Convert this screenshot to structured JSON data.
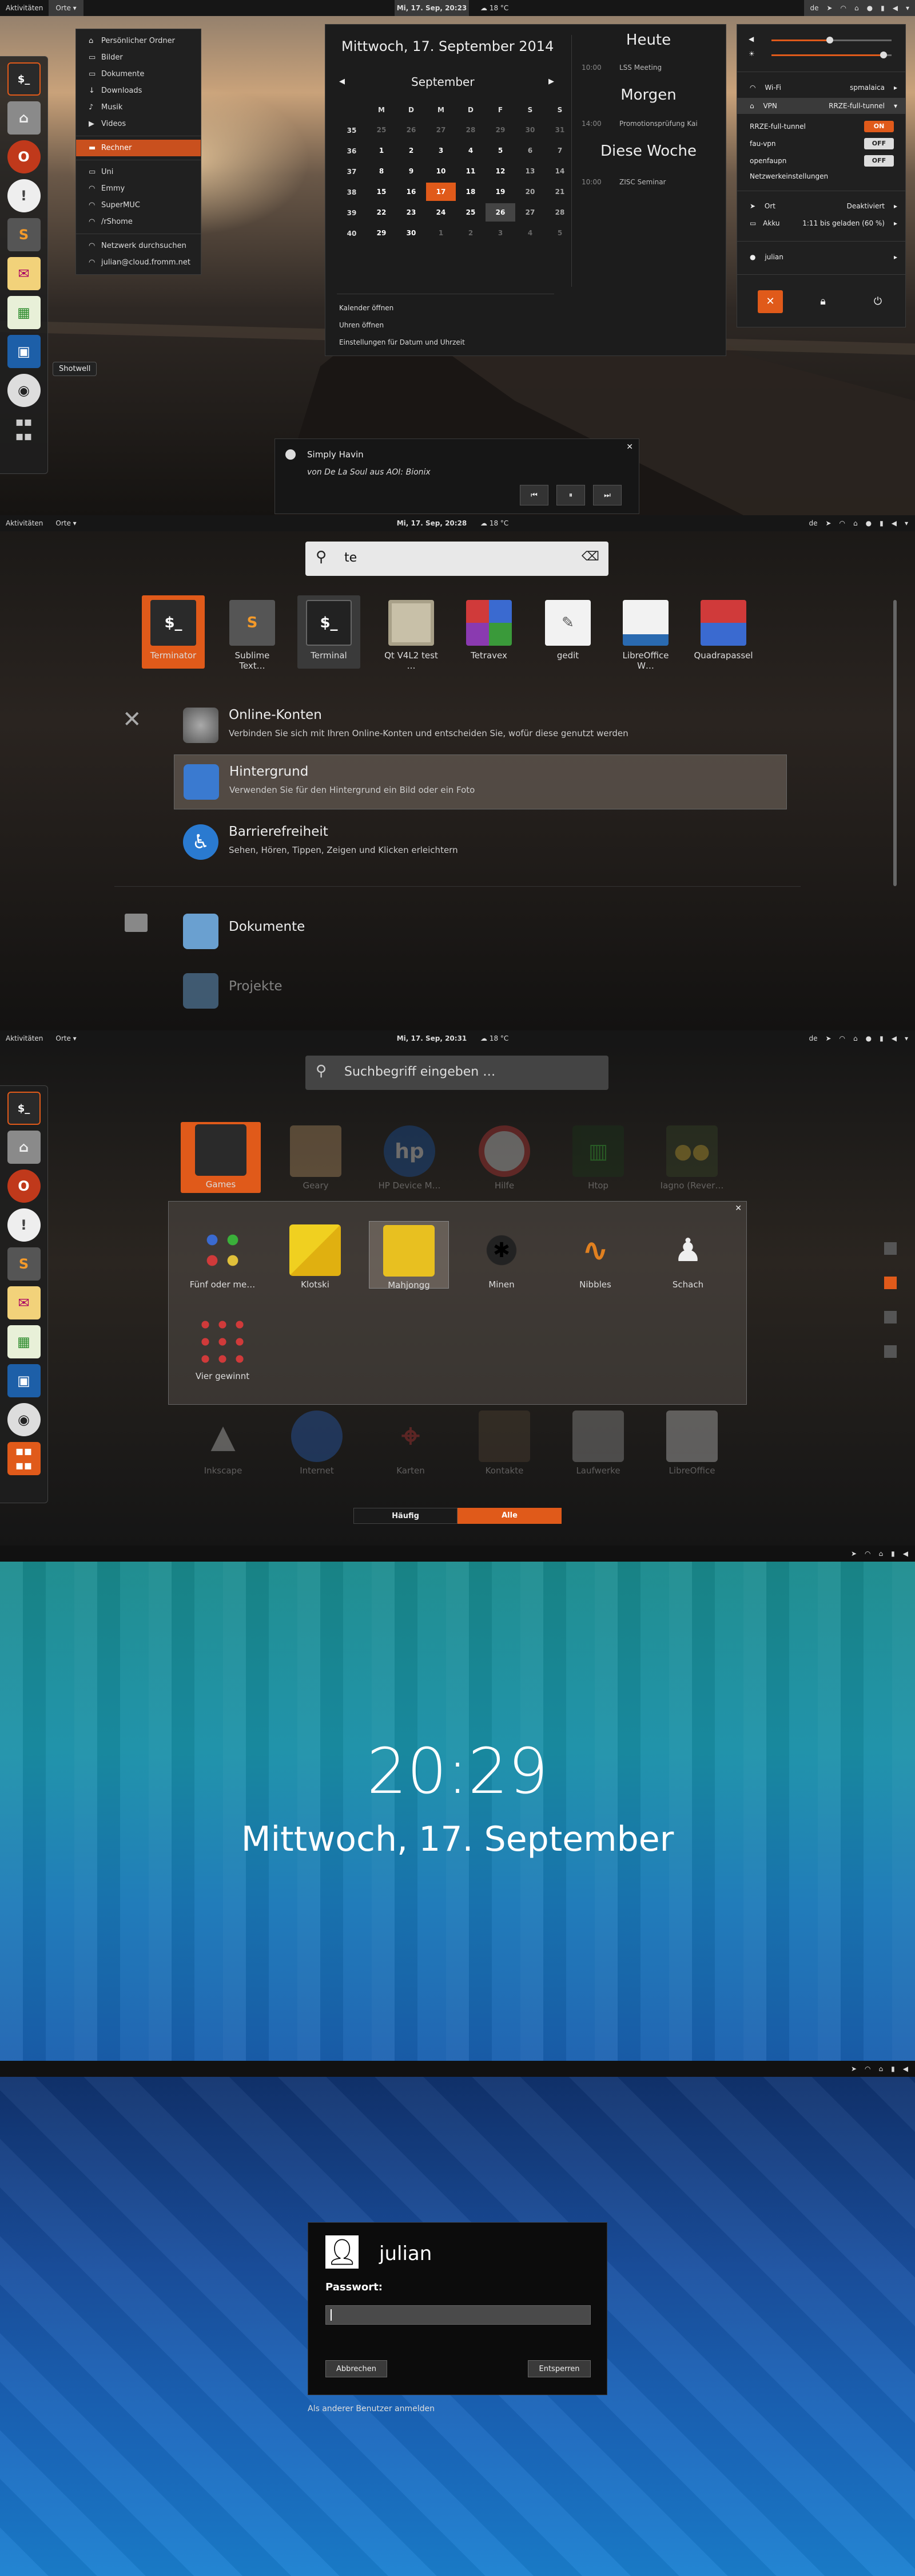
{
  "s1": {
    "topbar": {
      "activities": "Aktivitäten",
      "places": "Orte",
      "clock": "Mi, 17. Sep, 20:23",
      "temp": "18 °C",
      "lang": "de"
    },
    "places_menu": [
      "Persönlicher Ordner",
      "Bilder",
      "Dokumente",
      "Downloads",
      "Musik",
      "Videos",
      "Rechner",
      "Uni",
      "Emmy",
      "SuperMUC",
      "/rShome",
      "Netzwerk durchsuchen",
      "julian@cloud.fromm.net"
    ],
    "dock_tooltip": "Shotwell",
    "calendar": {
      "date_title": "Mittwoch, 17. September 2014",
      "month": "September",
      "weekdays": [
        "M",
        "D",
        "M",
        "D",
        "F",
        "S",
        "S"
      ],
      "weeks": [
        {
          "w": "35",
          "d": [
            "25",
            "26",
            "27",
            "28",
            "29",
            "30",
            "31"
          ]
        },
        {
          "w": "36",
          "d": [
            "1",
            "2",
            "3",
            "4",
            "5",
            "6",
            "7"
          ]
        },
        {
          "w": "37",
          "d": [
            "8",
            "9",
            "10",
            "11",
            "12",
            "13",
            "14"
          ]
        },
        {
          "w": "38",
          "d": [
            "15",
            "16",
            "17",
            "18",
            "19",
            "20",
            "21"
          ]
        },
        {
          "w": "39",
          "d": [
            "22",
            "23",
            "24",
            "25",
            "26",
            "27",
            "28"
          ]
        },
        {
          "w": "40",
          "d": [
            "29",
            "30",
            "1",
            "2",
            "3",
            "4",
            "5"
          ]
        }
      ],
      "today_label": "Heute",
      "today_events": [
        {
          "time": "10:00",
          "text": "LSS Meeting"
        }
      ],
      "tomorrow_label": "Morgen",
      "tomorrow_events": [
        {
          "time": "14:00",
          "text": "Promotionsprüfung Kai"
        }
      ],
      "week_label": "Diese Woche",
      "week_events": [
        {
          "time": "10:00",
          "text": "ZISC Seminar"
        }
      ],
      "links": [
        "Kalender öffnen",
        "Uhren öffnen",
        "Einstellungen für Datum und Uhrzeit"
      ]
    },
    "status_menu": {
      "wifi_label": "Wi-Fi",
      "wifi_value": "spmalaica",
      "vpn_label": "VPN",
      "vpn_value": "RRZE-full-tunnel",
      "vpns": [
        {
          "name": "RRZE-full-tunnel",
          "state": "ON"
        },
        {
          "name": "fau-vpn",
          "state": "OFF"
        },
        {
          "name": "openfaupn",
          "state": "OFF"
        }
      ],
      "net_settings": "Netzwerkeinstellungen",
      "location_label": "Ort",
      "location_value": "Deaktiviert",
      "battery_label": "Akku",
      "battery_value": "1:11 bis geladen (60 %)",
      "user": "julian"
    },
    "notification": {
      "title": "Simply Havin",
      "subtitle": "von De La Soul aus AOI: Bionix"
    }
  },
  "s2": {
    "topbar": {
      "activities": "Aktivitäten",
      "places": "Orte",
      "clock": "Mi, 17. Sep, 20:28",
      "temp": "18 °C",
      "lang": "de"
    },
    "search": "te",
    "apps": [
      {
        "name": "Terminator",
        "glyph": "$_"
      },
      {
        "name": "Sublime Text…",
        "glyph": "S"
      },
      {
        "name": "Terminal",
        "glyph": "$_"
      },
      {
        "name": "Qt V4L2 test …",
        "glyph": ""
      },
      {
        "name": "Tetravex",
        "glyph": ""
      },
      {
        "name": "gedit",
        "glyph": "✎"
      },
      {
        "name": "LibreOffice W…",
        "glyph": ""
      },
      {
        "name": "Quadrapassel",
        "glyph": ""
      }
    ],
    "settings": [
      {
        "title": "Online-Konten",
        "desc": "Verbinden Sie sich mit Ihren Online-Konten und entscheiden Sie, wofür diese genutzt werden"
      },
      {
        "title": "Hintergrund",
        "desc": "Verwenden Sie für den Hintergrund ein Bild oder ein Foto"
      },
      {
        "title": "Barrierefreiheit",
        "desc": "Sehen, Hören, Tippen, Zeigen und Klicken erleichtern"
      }
    ],
    "files": [
      {
        "title": "Dokumente"
      },
      {
        "title": "Projekte"
      }
    ]
  },
  "s3": {
    "topbar": {
      "activities": "Aktivitäten",
      "places": "Orte",
      "clock": "Mi, 17. Sep, 20:31",
      "temp": "18 °C",
      "lang": "de"
    },
    "search_placeholder": "Suchbegriff eingeben …",
    "row1": [
      "Games",
      "Geary",
      "HP Device M…",
      "Hilfe",
      "Htop",
      "Iagno (Rever…"
    ],
    "folder": [
      "Fünf oder me…",
      "Klotski",
      "Mahjongg",
      "Minen",
      "Nibbles",
      "Schach",
      "Vier gewinnt"
    ],
    "row3": [
      "Inkscape",
      "Internet",
      "Karten",
      "Kontakte",
      "Laufwerke",
      "LibreOffice"
    ],
    "tabs": [
      "Häufig",
      "Alle"
    ]
  },
  "s4": {
    "time": "20:29",
    "date": "Mittwoch, 17. September"
  },
  "s5": {
    "user": "julian",
    "password_label": "Passwort:",
    "cancel": "Abbrechen",
    "unlock": "Entsperren",
    "other_user": "Als anderer Benutzer anmelden"
  }
}
